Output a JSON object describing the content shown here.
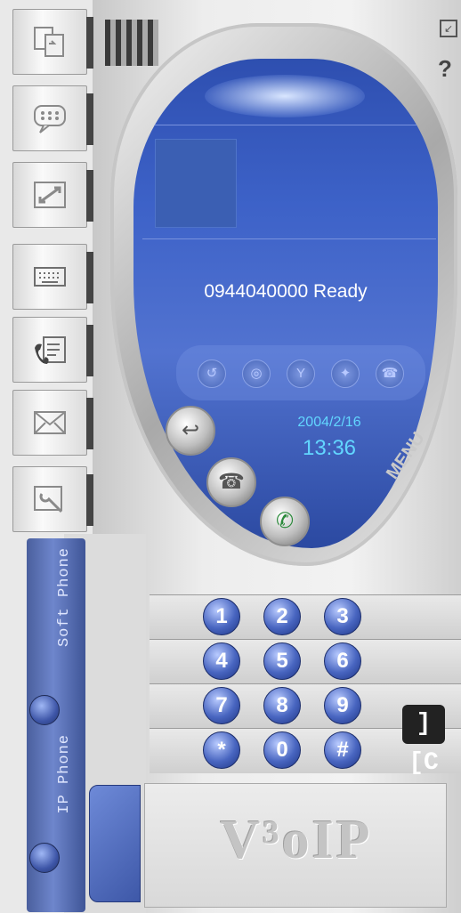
{
  "window": {
    "minimize_icon": "minimize-icon",
    "help_label": "?"
  },
  "toolbar": {
    "items": [
      {
        "name": "copy-icon"
      },
      {
        "name": "chat-icon"
      },
      {
        "name": "transfer-icon"
      },
      {
        "name": "keyboard-icon"
      },
      {
        "name": "phone-note-icon"
      },
      {
        "name": "mail-icon"
      },
      {
        "name": "tools-icon"
      }
    ]
  },
  "mode": {
    "soft_phone_label": "Soft Phone",
    "ip_phone_label": "IP Phone"
  },
  "screen": {
    "status": "0944040000 Ready",
    "date": "2004/2/16",
    "time": "13:36"
  },
  "controls": {
    "menu_label": "MENU"
  },
  "keypad": {
    "rows": [
      [
        "1",
        "2",
        "3"
      ],
      [
        "4",
        "5",
        "6"
      ],
      [
        "7",
        "8",
        "9"
      ],
      [
        "*",
        "0",
        "#"
      ]
    ]
  },
  "logo": {
    "text": "V³oIP",
    "brand_glyph": "][C"
  },
  "colors": {
    "screen_blue": "#3d62c8",
    "digit_blue": "#4865c0",
    "time_cyan": "#62d6ff"
  }
}
